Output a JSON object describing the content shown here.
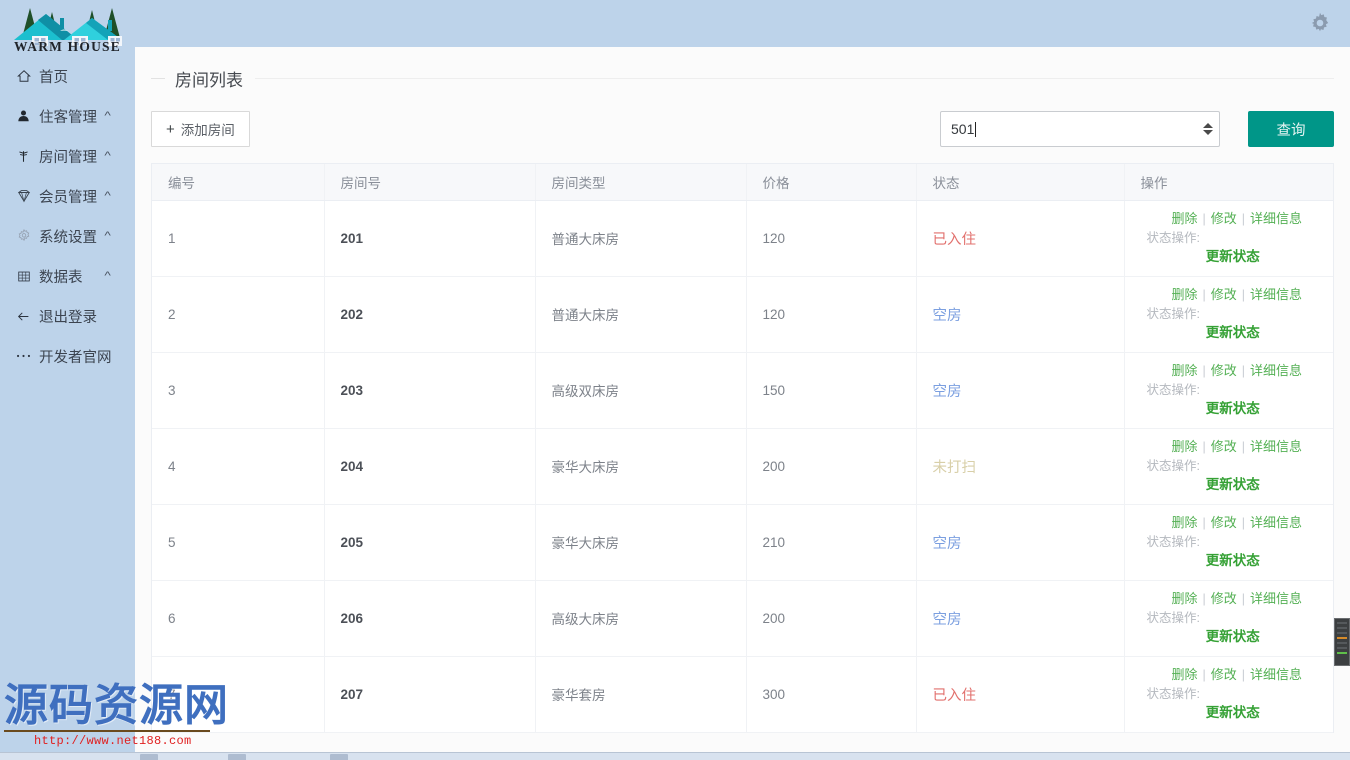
{
  "brand": {
    "name": "WARM HOUSE",
    "logo_icon": "house-trees-logo"
  },
  "topbar": {
    "gear_icon": "gear-icon"
  },
  "sidebar": {
    "items": [
      {
        "label": "首页",
        "icon": "home-icon",
        "caret": "",
        "muted": false
      },
      {
        "label": "住客管理",
        "icon": "user-icon",
        "caret": "^",
        "muted": false
      },
      {
        "label": "房间管理",
        "icon": "tree-icon",
        "caret": "^",
        "muted": false
      },
      {
        "label": "会员管理",
        "icon": "diamond-icon",
        "caret": "^",
        "muted": false
      },
      {
        "label": "系统设置",
        "icon": "gear-icon",
        "caret": "^",
        "muted": true
      },
      {
        "label": "数据表",
        "icon": "grid-icon",
        "caret": "^",
        "muted": false
      },
      {
        "label": "退出登录",
        "icon": "arrow-left-icon",
        "caret": "",
        "muted": false
      },
      {
        "label": "开发者官网",
        "icon": "ellipsis-icon",
        "caret": "",
        "muted": false
      }
    ]
  },
  "panel": {
    "title": "房间列表"
  },
  "toolbar": {
    "add_label": "添加房间",
    "add_plus": "+",
    "query_label": "查询"
  },
  "search": {
    "value": "501",
    "placeholder": "",
    "spinner_icon": "number-stepper-icon"
  },
  "table": {
    "columns": [
      "编号",
      "房间号",
      "房间类型",
      "价格",
      "状态",
      "操作"
    ],
    "ops": {
      "delete": "删除",
      "edit": "修改",
      "detail": "详细信息",
      "separator": "|",
      "state_label": "状态操作:",
      "update": "更新状态"
    },
    "rows": [
      {
        "no": "1",
        "room": "201",
        "type": "普通大床房",
        "price": "120",
        "status": "已入住",
        "status_kind": "occupied"
      },
      {
        "no": "2",
        "room": "202",
        "type": "普通大床房",
        "price": "120",
        "status": "空房",
        "status_kind": "vacant"
      },
      {
        "no": "3",
        "room": "203",
        "type": "高级双床房",
        "price": "150",
        "status": "空房",
        "status_kind": "vacant"
      },
      {
        "no": "4",
        "room": "204",
        "type": "豪华大床房",
        "price": "200",
        "status": "未打扫",
        "status_kind": "dirty"
      },
      {
        "no": "5",
        "room": "205",
        "type": "豪华大床房",
        "price": "210",
        "status": "空房",
        "status_kind": "vacant"
      },
      {
        "no": "6",
        "room": "206",
        "type": "高级大床房",
        "price": "200",
        "status": "空房",
        "status_kind": "vacant"
      },
      {
        "no": "7",
        "room": "207",
        "type": "豪华套房",
        "price": "300",
        "status": "已入住",
        "status_kind": "occupied"
      }
    ]
  },
  "watermark": {
    "text": "源码资源网",
    "url": "http://www.net188.com"
  },
  "colors": {
    "header_blue": "#bdd3ea",
    "accent_teal": "#009688",
    "link_green": "#54b054",
    "status_occupied": "#e2706d",
    "status_vacant": "#7b9fe0",
    "status_dirty": "#d8cfa8",
    "watermark_blue": "#3f6fbf",
    "watermark_red": "#e02020"
  }
}
